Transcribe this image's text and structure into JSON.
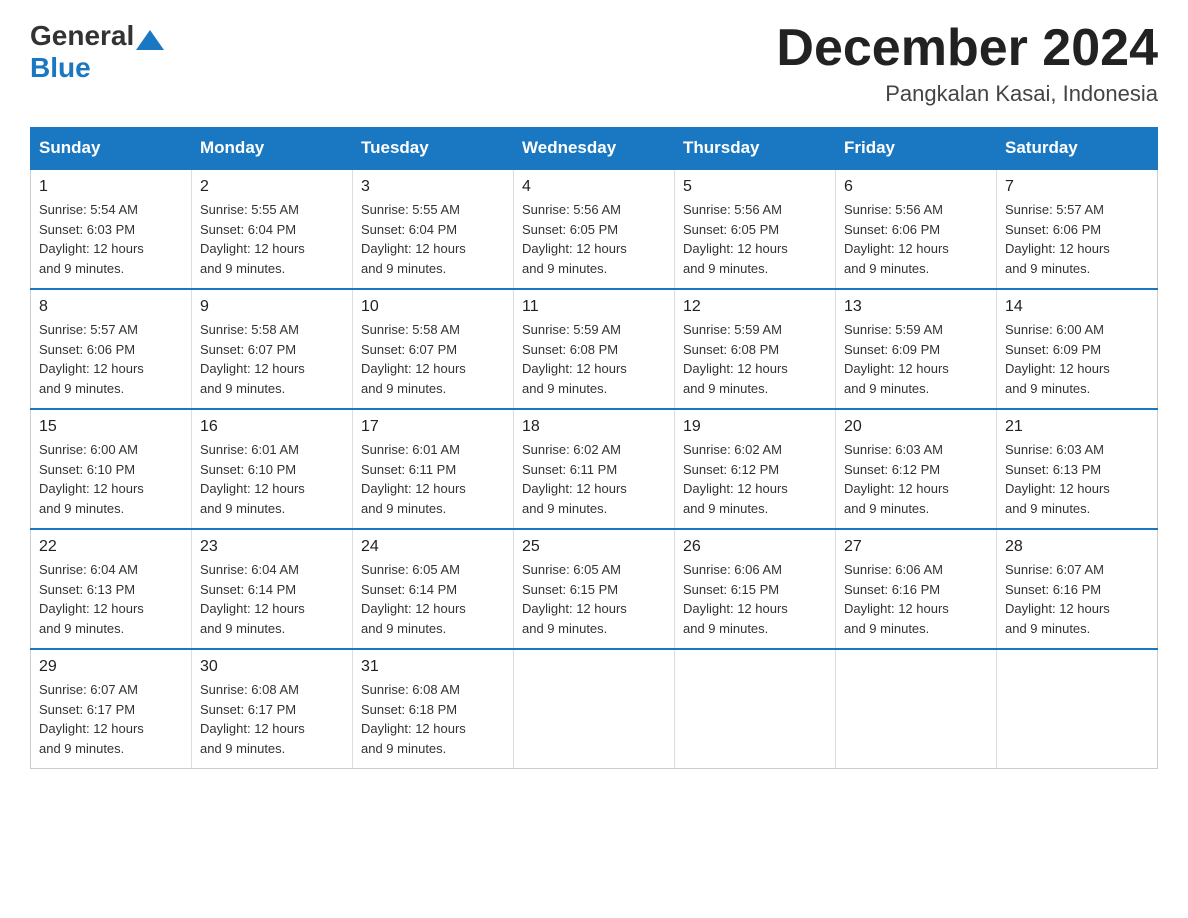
{
  "header": {
    "logo_general": "General",
    "logo_blue": "Blue",
    "month_title": "December 2024",
    "location": "Pangkalan Kasai, Indonesia"
  },
  "days_of_week": [
    "Sunday",
    "Monday",
    "Tuesday",
    "Wednesday",
    "Thursday",
    "Friday",
    "Saturday"
  ],
  "weeks": [
    [
      {
        "day": "1",
        "sunrise": "5:54 AM",
        "sunset": "6:03 PM",
        "daylight": "12 hours and 9 minutes."
      },
      {
        "day": "2",
        "sunrise": "5:55 AM",
        "sunset": "6:04 PM",
        "daylight": "12 hours and 9 minutes."
      },
      {
        "day": "3",
        "sunrise": "5:55 AM",
        "sunset": "6:04 PM",
        "daylight": "12 hours and 9 minutes."
      },
      {
        "day": "4",
        "sunrise": "5:56 AM",
        "sunset": "6:05 PM",
        "daylight": "12 hours and 9 minutes."
      },
      {
        "day": "5",
        "sunrise": "5:56 AM",
        "sunset": "6:05 PM",
        "daylight": "12 hours and 9 minutes."
      },
      {
        "day": "6",
        "sunrise": "5:56 AM",
        "sunset": "6:06 PM",
        "daylight": "12 hours and 9 minutes."
      },
      {
        "day": "7",
        "sunrise": "5:57 AM",
        "sunset": "6:06 PM",
        "daylight": "12 hours and 9 minutes."
      }
    ],
    [
      {
        "day": "8",
        "sunrise": "5:57 AM",
        "sunset": "6:06 PM",
        "daylight": "12 hours and 9 minutes."
      },
      {
        "day": "9",
        "sunrise": "5:58 AM",
        "sunset": "6:07 PM",
        "daylight": "12 hours and 9 minutes."
      },
      {
        "day": "10",
        "sunrise": "5:58 AM",
        "sunset": "6:07 PM",
        "daylight": "12 hours and 9 minutes."
      },
      {
        "day": "11",
        "sunrise": "5:59 AM",
        "sunset": "6:08 PM",
        "daylight": "12 hours and 9 minutes."
      },
      {
        "day": "12",
        "sunrise": "5:59 AM",
        "sunset": "6:08 PM",
        "daylight": "12 hours and 9 minutes."
      },
      {
        "day": "13",
        "sunrise": "5:59 AM",
        "sunset": "6:09 PM",
        "daylight": "12 hours and 9 minutes."
      },
      {
        "day": "14",
        "sunrise": "6:00 AM",
        "sunset": "6:09 PM",
        "daylight": "12 hours and 9 minutes."
      }
    ],
    [
      {
        "day": "15",
        "sunrise": "6:00 AM",
        "sunset": "6:10 PM",
        "daylight": "12 hours and 9 minutes."
      },
      {
        "day": "16",
        "sunrise": "6:01 AM",
        "sunset": "6:10 PM",
        "daylight": "12 hours and 9 minutes."
      },
      {
        "day": "17",
        "sunrise": "6:01 AM",
        "sunset": "6:11 PM",
        "daylight": "12 hours and 9 minutes."
      },
      {
        "day": "18",
        "sunrise": "6:02 AM",
        "sunset": "6:11 PM",
        "daylight": "12 hours and 9 minutes."
      },
      {
        "day": "19",
        "sunrise": "6:02 AM",
        "sunset": "6:12 PM",
        "daylight": "12 hours and 9 minutes."
      },
      {
        "day": "20",
        "sunrise": "6:03 AM",
        "sunset": "6:12 PM",
        "daylight": "12 hours and 9 minutes."
      },
      {
        "day": "21",
        "sunrise": "6:03 AM",
        "sunset": "6:13 PM",
        "daylight": "12 hours and 9 minutes."
      }
    ],
    [
      {
        "day": "22",
        "sunrise": "6:04 AM",
        "sunset": "6:13 PM",
        "daylight": "12 hours and 9 minutes."
      },
      {
        "day": "23",
        "sunrise": "6:04 AM",
        "sunset": "6:14 PM",
        "daylight": "12 hours and 9 minutes."
      },
      {
        "day": "24",
        "sunrise": "6:05 AM",
        "sunset": "6:14 PM",
        "daylight": "12 hours and 9 minutes."
      },
      {
        "day": "25",
        "sunrise": "6:05 AM",
        "sunset": "6:15 PM",
        "daylight": "12 hours and 9 minutes."
      },
      {
        "day": "26",
        "sunrise": "6:06 AM",
        "sunset": "6:15 PM",
        "daylight": "12 hours and 9 minutes."
      },
      {
        "day": "27",
        "sunrise": "6:06 AM",
        "sunset": "6:16 PM",
        "daylight": "12 hours and 9 minutes."
      },
      {
        "day": "28",
        "sunrise": "6:07 AM",
        "sunset": "6:16 PM",
        "daylight": "12 hours and 9 minutes."
      }
    ],
    [
      {
        "day": "29",
        "sunrise": "6:07 AM",
        "sunset": "6:17 PM",
        "daylight": "12 hours and 9 minutes."
      },
      {
        "day": "30",
        "sunrise": "6:08 AM",
        "sunset": "6:17 PM",
        "daylight": "12 hours and 9 minutes."
      },
      {
        "day": "31",
        "sunrise": "6:08 AM",
        "sunset": "6:18 PM",
        "daylight": "12 hours and 9 minutes."
      },
      null,
      null,
      null,
      null
    ]
  ],
  "labels": {
    "sunrise": "Sunrise:",
    "sunset": "Sunset:",
    "daylight": "Daylight:"
  }
}
